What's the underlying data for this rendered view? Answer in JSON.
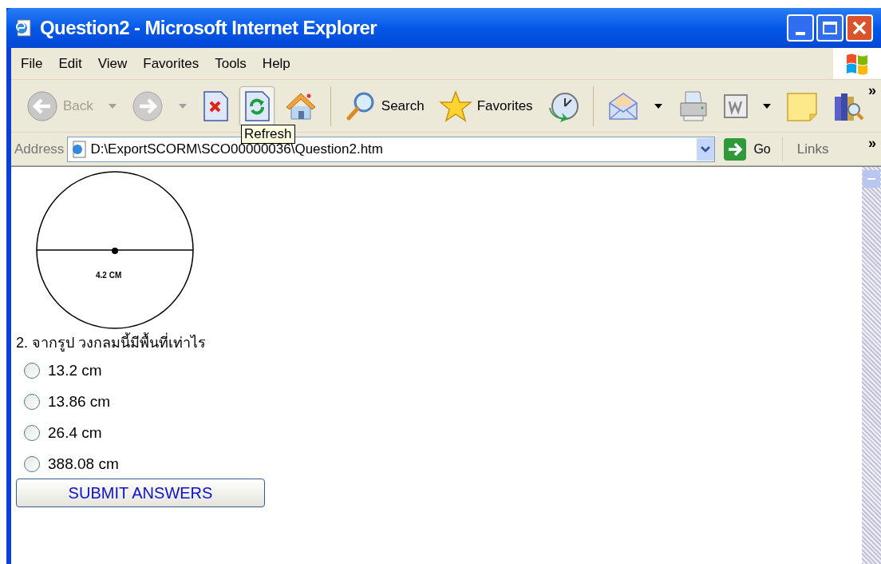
{
  "window": {
    "title": "Question2 - Microsoft Internet Explorer"
  },
  "menu": [
    {
      "label": "File"
    },
    {
      "label": "Edit"
    },
    {
      "label": "View"
    },
    {
      "label": "Favorites"
    },
    {
      "label": "Tools"
    },
    {
      "label": "Help"
    }
  ],
  "toolbar": {
    "items": [
      {
        "kind": "back",
        "label": "Back",
        "disabled": true,
        "hovered": false
      },
      {
        "kind": "dropdown",
        "disabled": true,
        "hovered": false
      },
      {
        "kind": "forward",
        "disabled": true,
        "hovered": false
      },
      {
        "kind": "dropdown",
        "disabled": true,
        "hovered": false
      },
      {
        "kind": "stop",
        "disabled": false,
        "hovered": false
      },
      {
        "kind": "refresh",
        "disabled": false,
        "hovered": true
      },
      {
        "kind": "home",
        "disabled": false,
        "hovered": false
      },
      {
        "kind": "separator"
      },
      {
        "kind": "search",
        "label": "Search",
        "disabled": false,
        "hovered": false
      },
      {
        "kind": "favorites",
        "label": "Favorites",
        "disabled": false,
        "hovered": false
      },
      {
        "kind": "history",
        "disabled": false,
        "hovered": false
      },
      {
        "kind": "separator"
      },
      {
        "kind": "mail",
        "disabled": false,
        "hovered": false
      },
      {
        "kind": "dropdown",
        "disabled": false,
        "hovered": false
      },
      {
        "kind": "print",
        "disabled": false,
        "hovered": false
      },
      {
        "kind": "word",
        "disabled": false,
        "hovered": false
      },
      {
        "kind": "dropdown",
        "disabled": false,
        "hovered": false
      },
      {
        "kind": "note",
        "disabled": false,
        "hovered": false
      },
      {
        "kind": "research",
        "disabled": false,
        "hovered": false
      }
    ],
    "overflow": "»",
    "tooltip": "Refresh"
  },
  "address_bar": {
    "label": "Address",
    "value": "D:\\ExportSCORM\\SCO00000036\\Question2.htm",
    "go": "Go",
    "links": "Links",
    "overflow": "»"
  },
  "content": {
    "figure_label": "4.2 CM",
    "question": "2. จากรูป วงกลมนี้มีพื้นที่เท่าไร",
    "options": [
      {
        "label": "13.2 cm",
        "selected": false
      },
      {
        "label": "13.86 cm",
        "selected": false
      },
      {
        "label": "26.4 cm",
        "selected": false
      },
      {
        "label": "388.08 cm",
        "selected": false
      }
    ],
    "submit": "SUBMIT ANSWERS"
  }
}
